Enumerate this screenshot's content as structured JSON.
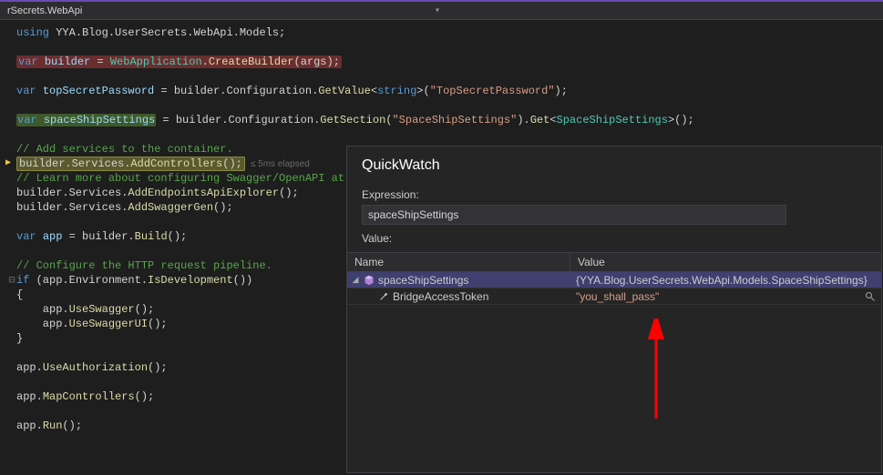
{
  "tab": {
    "title": "rSecrets.WebApi"
  },
  "code": {
    "l1": "using YYA.Blog.UserSecrets.WebApi.Models;",
    "l3_a": "var ",
    "l3_b": "builder",
    "l3_c": " = WebApplication.CreateBuilder(args);",
    "l5_a": "var ",
    "l5_b": "topSecretPassword",
    "l5_c": " = builder.Configuration.GetValue<",
    "l5_d": "string",
    "l5_e": ">(",
    "l5_f": "\"TopSecretPassword\"",
    "l5_g": ");",
    "l7_a": "var ",
    "l7_b": "spaceShipSettings",
    "l7_c": " = builder.Configuration.GetSection(",
    "l7_d": "\"SpaceShipSettings\"",
    "l7_e": ").Get<",
    "l7_f": "SpaceShipSettings",
    "l7_g": ">();",
    "c1": "// Add services to the container.",
    "break": "builder.Services.AddControllers();",
    "codelens": "≤ 5ms elapsed",
    "c2": "// Learn more about configuring Swagger/OpenAPI at ",
    "l11": "builder.Services.AddEndpointsApiExplorer();",
    "l12": "builder.Services.AddSwaggerGen();",
    "l14_a": "var ",
    "l14_b": "app",
    "l14_c": " = builder.Build();",
    "c3": "// Configure the HTTP request pipeline.",
    "l17_a": "if ",
    "l17_b": "(app.Environment.IsDevelopment())",
    "l18": "{",
    "l19": "    app.UseSwagger();",
    "l20": "    app.UseSwaggerUI();",
    "l21": "}",
    "l23": "app.UseAuthorization();",
    "l25": "app.MapControllers();",
    "l27": "app.Run();"
  },
  "quickwatch": {
    "title": "QuickWatch",
    "expr_label": "Expression:",
    "expr_value": "spaceShipSettings",
    "value_label": "Value:",
    "cols": {
      "name": "Name",
      "value": "Value"
    },
    "rows": [
      {
        "name": "spaceShipSettings",
        "value": "{YYA.Blog.UserSecrets.WebApi.Models.SpaceShipSettings}"
      },
      {
        "name": "BridgeAccessToken",
        "value": "\"you_shall_pass\""
      }
    ]
  },
  "annotation": {
    "color": "#ff0000"
  }
}
